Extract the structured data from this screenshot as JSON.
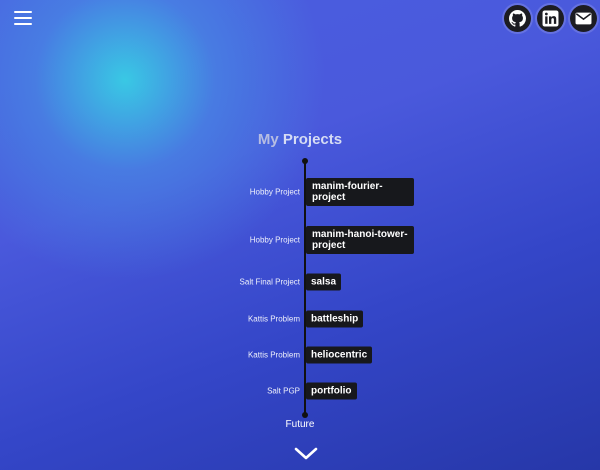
{
  "header": {
    "menu_icon": "hamburger-icon",
    "social": [
      {
        "name": "github",
        "icon": "github-icon"
      },
      {
        "name": "linkedin",
        "icon": "linkedin-icon"
      },
      {
        "name": "email",
        "icon": "envelope-icon"
      }
    ]
  },
  "section": {
    "title_prefix": "My",
    "title_main": "Projects"
  },
  "timeline": {
    "items": [
      {
        "category": "Hobby Project",
        "name": "manim-fourier-project"
      },
      {
        "category": "Hobby Project",
        "name": "manim-hanoi-tower-project"
      },
      {
        "category": "Salt Final Project",
        "name": "salsa"
      },
      {
        "category": "Kattis Problem",
        "name": "battleship"
      },
      {
        "category": "Kattis Problem",
        "name": "heliocentric"
      },
      {
        "category": "Salt PGP",
        "name": "portfolio"
      }
    ],
    "end_label": "Future"
  },
  "scroll_icon": "chevron-down-icon",
  "colors": {
    "accent_glow": "#38cee4",
    "background": "#3446c8",
    "tag_background": "#17181c"
  }
}
